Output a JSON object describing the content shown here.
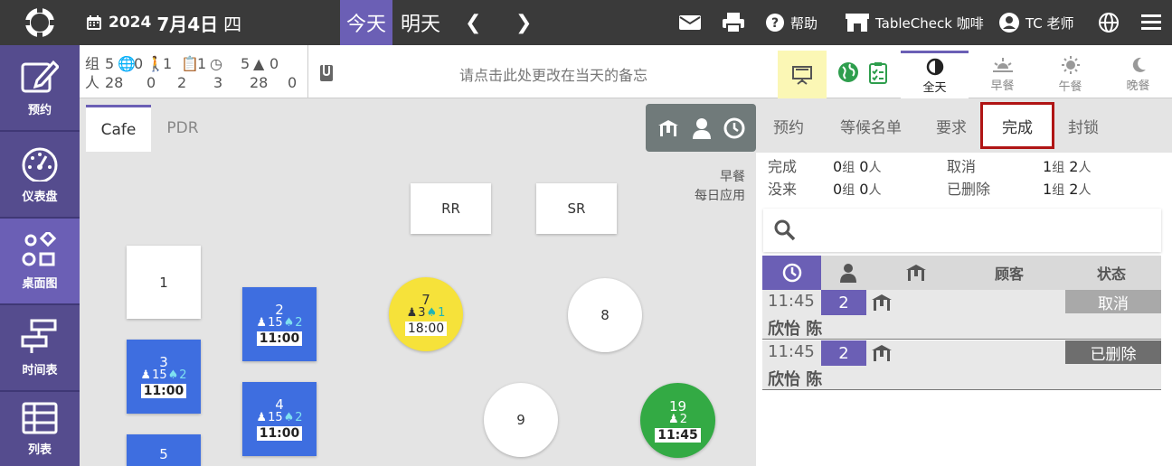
{
  "topbar": {
    "year": "2024",
    "date": "7月4日",
    "weekday": "四",
    "today_label": "今天",
    "tomorrow_label": "明天",
    "help_label": "帮助",
    "venue_name": "TableCheck 咖啡",
    "user_name": "TC 老师"
  },
  "sidebar": {
    "items": [
      {
        "label": "预约",
        "icon": "edit-icon"
      },
      {
        "label": "仪表盘",
        "icon": "dashboard-icon"
      },
      {
        "label": "桌面图",
        "icon": "floorplan-icon"
      },
      {
        "label": "时间表",
        "icon": "timeline-icon"
      },
      {
        "label": "列表",
        "icon": "list-icon"
      }
    ]
  },
  "stats": {
    "group_label": "组",
    "people_label": "人",
    "groups": [
      "5",
      "0",
      "1",
      "1",
      "5",
      "0"
    ],
    "people": [
      "28",
      "0",
      "2",
      "3",
      "28",
      "0"
    ]
  },
  "memo": {
    "placeholder": "请点击此处更改在当天的备忘"
  },
  "meals": [
    {
      "label": "全天",
      "icon": "half-moon-icon"
    },
    {
      "label": "早餐",
      "icon": "sunrise-icon"
    },
    {
      "label": "午餐",
      "icon": "sun-icon"
    },
    {
      "label": "晚餐",
      "icon": "moon-icon"
    }
  ],
  "floor_tabs": [
    "Cafe",
    "PDR"
  ],
  "floor_meal": {
    "line1": "早餐",
    "line2": "每日应用"
  },
  "tables": [
    {
      "id": "1"
    },
    {
      "id": "2",
      "guests": "15",
      "kids": "2",
      "time": "11:00"
    },
    {
      "id": "3",
      "guests": "15",
      "kids": "2",
      "time": "11:00"
    },
    {
      "id": "4",
      "guests": "15",
      "kids": "2",
      "time": "11:00"
    },
    {
      "id": "5"
    },
    {
      "id": "7",
      "guests": "3",
      "kids": "1",
      "time": "18:00"
    },
    {
      "id": "8"
    },
    {
      "id": "9"
    },
    {
      "id": "19",
      "guests": "2",
      "time": "11:45"
    },
    {
      "id": "RR"
    },
    {
      "id": "SR"
    }
  ],
  "right_tabs": [
    "预约",
    "等候名单",
    "要求",
    "完成",
    "封锁"
  ],
  "summary": {
    "done_label": "完成",
    "done_groups": "0",
    "done_people": "0",
    "noshow_label": "没来",
    "noshow_groups": "0",
    "noshow_people": "0",
    "cancel_label": "取消",
    "cancel_groups": "1",
    "cancel_people": "2",
    "deleted_label": "已删除",
    "deleted_groups": "1",
    "deleted_people": "2",
    "group_unit": "组",
    "people_unit": "人"
  },
  "list_header": {
    "guest": "顾客",
    "status": "状态"
  },
  "reservations": [
    {
      "time": "11:45",
      "party": "2",
      "name": "欣怡 陈",
      "status": "取消",
      "status_color": "#a9a9a9"
    },
    {
      "time": "11:45",
      "party": "2",
      "name": "欣怡 陈",
      "status": "已删除",
      "status_color": "#6e6e6e"
    }
  ],
  "colors": {
    "accent": "#6b5fb5",
    "nav_bg": "#554c8e",
    "topbar": "#3a3a3a",
    "table_blue": "#3e6ee0",
    "table_yellow": "#f6e23a",
    "table_green": "#33aa44",
    "highlight": "#b01515"
  }
}
